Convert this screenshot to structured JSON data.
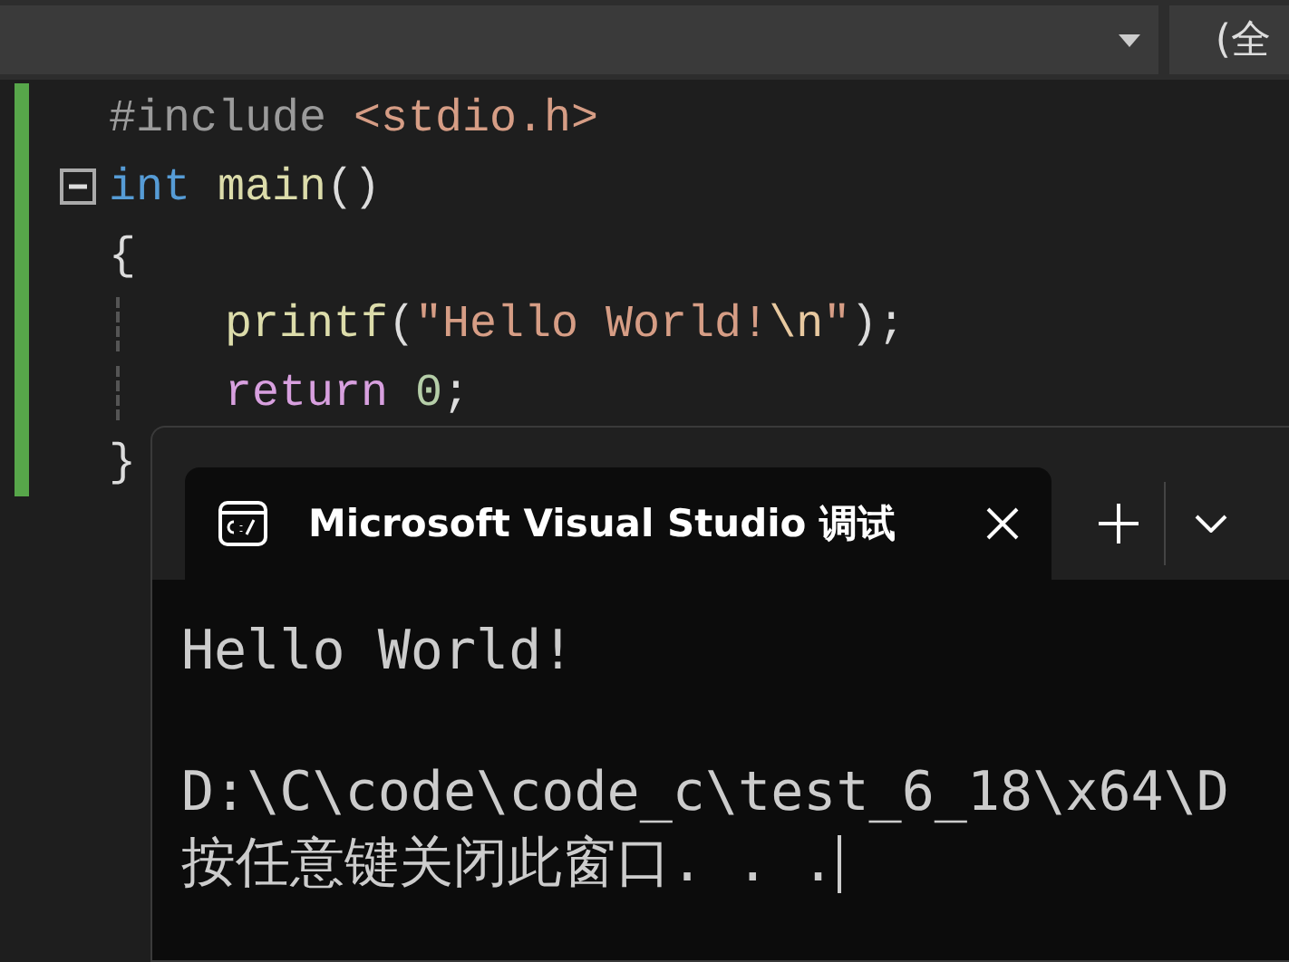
{
  "toolbar": {
    "dropdowns": [
      {
        "kind": "caret"
      },
      {
        "kind": "text",
        "value": "(全"
      }
    ]
  },
  "editor": {
    "lines": [
      {
        "collapsible": false,
        "tokens": [
          {
            "kind": "preprocessor",
            "text": "#include "
          },
          {
            "kind": "string",
            "text": "<stdio.h>"
          }
        ]
      },
      {
        "collapsible": true,
        "tokens": [
          {
            "kind": "keyword",
            "text": "int "
          },
          {
            "kind": "function",
            "text": "main"
          },
          {
            "kind": "plain",
            "text": "()"
          }
        ]
      },
      {
        "collapsible": false,
        "tokens": [
          {
            "kind": "plain",
            "text": "{"
          }
        ]
      },
      {
        "collapsible": false,
        "tokens": [
          {
            "kind": "indent"
          },
          {
            "kind": "function",
            "text": "printf"
          },
          {
            "kind": "plain",
            "text": "("
          },
          {
            "kind": "string",
            "text": "\"Hello World!"
          },
          {
            "kind": "escape",
            "text": "\\n"
          },
          {
            "kind": "string",
            "text": "\""
          },
          {
            "kind": "plain",
            "text": ");"
          }
        ]
      },
      {
        "collapsible": false,
        "tokens": [
          {
            "kind": "indent"
          },
          {
            "kind": "control",
            "text": "return "
          },
          {
            "kind": "number",
            "text": "0"
          },
          {
            "kind": "plain",
            "text": ";"
          }
        ]
      },
      {
        "collapsible": false,
        "tokens": [
          {
            "kind": "plain",
            "text": "}"
          }
        ]
      }
    ]
  },
  "terminal": {
    "tab": {
      "title": "Microsoft Visual Studio 调试",
      "selected": true
    },
    "output": [
      {
        "kind": "text",
        "text": "Hello World!"
      },
      {
        "kind": "blank"
      },
      {
        "kind": "text",
        "text": "D:\\C\\code\\code_c\\test_6_18\\x64\\D"
      },
      {
        "kind": "text",
        "text": "按任意键关闭此窗口. . ."
      }
    ]
  }
}
